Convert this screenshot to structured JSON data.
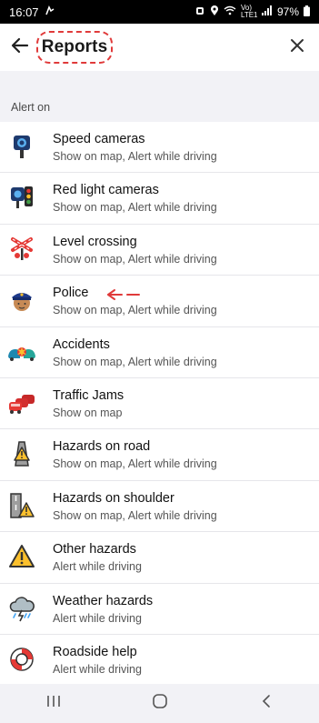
{
  "status_bar": {
    "time": "16:07",
    "network": "Vo) LTE1",
    "battery": "97%"
  },
  "header": {
    "title": "Reports",
    "back_icon": "arrow-left-icon",
    "close_icon": "close-icon"
  },
  "section": {
    "label": "Alert on"
  },
  "items": [
    {
      "name": "Speed cameras",
      "sub": "Show on map, Alert while driving",
      "icon": "speed-camera-icon"
    },
    {
      "name": "Red light cameras",
      "sub": "Show on map, Alert while driving",
      "icon": "red-light-camera-icon"
    },
    {
      "name": "Level crossing",
      "sub": "Show on map, Alert while driving",
      "icon": "level-crossing-icon"
    },
    {
      "name": "Police",
      "sub": "Show on map, Alert while driving",
      "icon": "police-icon"
    },
    {
      "name": "Accidents",
      "sub": "Show on map, Alert while driving",
      "icon": "accident-icon"
    },
    {
      "name": "Traffic Jams",
      "sub": "Show on map",
      "icon": "traffic-jam-icon"
    },
    {
      "name": "Hazards on road",
      "sub": "Show on map, Alert while driving",
      "icon": "hazard-road-icon"
    },
    {
      "name": "Hazards on shoulder",
      "sub": "Show on map, Alert while driving",
      "icon": "hazard-shoulder-icon"
    },
    {
      "name": "Other hazards",
      "sub": "Alert while driving",
      "icon": "warning-icon"
    },
    {
      "name": "Weather hazards",
      "sub": "Alert while driving",
      "icon": "weather-icon"
    },
    {
      "name": "Roadside help",
      "sub": "Alert while driving",
      "icon": "lifebuoy-icon"
    }
  ],
  "colors": {
    "annotation": "#e03a3a",
    "section_bg": "#f2f2f6"
  }
}
